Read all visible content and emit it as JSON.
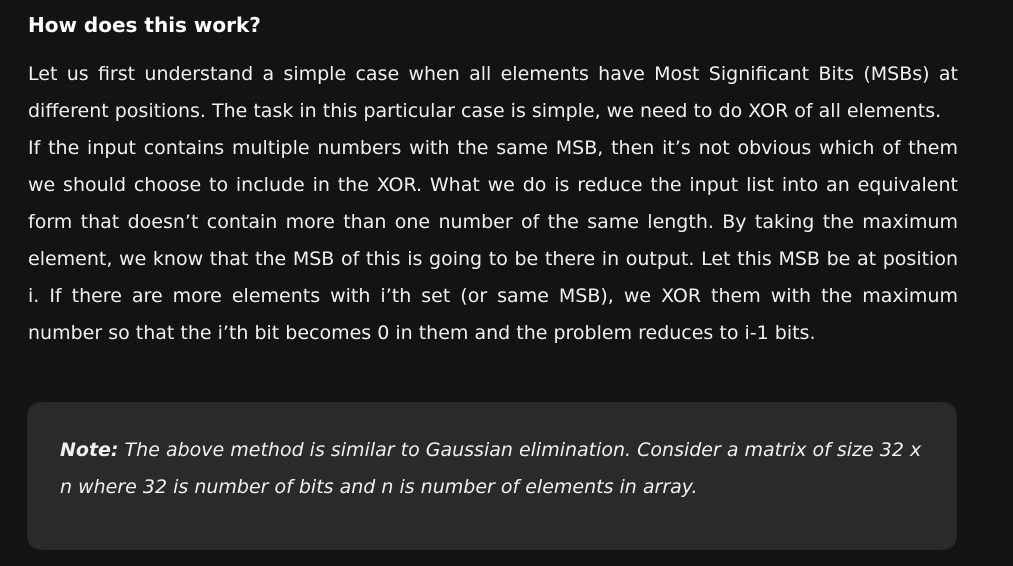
{
  "heading": "How does this work?",
  "paragraphs": [
    "Let us first understand a simple case when all elements have Most Significant Bits (MSBs) at different positions. The task in this particular case is simple, we need to do XOR of all elements.",
    "If the input contains multiple numbers with the same MSB, then it’s not obvious which of them we should choose to include in the XOR. What we do is reduce the input list into an equivalent form that doesn’t contain more than one number of the same length. By taking the maximum element, we know that the MSB of this is going to be there in output. Let this MSB be at position i. If there are more elements with i’th set (or same MSB), we XOR them with the maximum number so that the i’th bit becomes 0 in them and the problem reduces to i-1 bits."
  ],
  "note": {
    "label": "Note:",
    "text": " The above method is similar to Gaussian elimination. Consider a matrix of size 32 x n where 32 is number of bits and n is number of elements in array."
  }
}
